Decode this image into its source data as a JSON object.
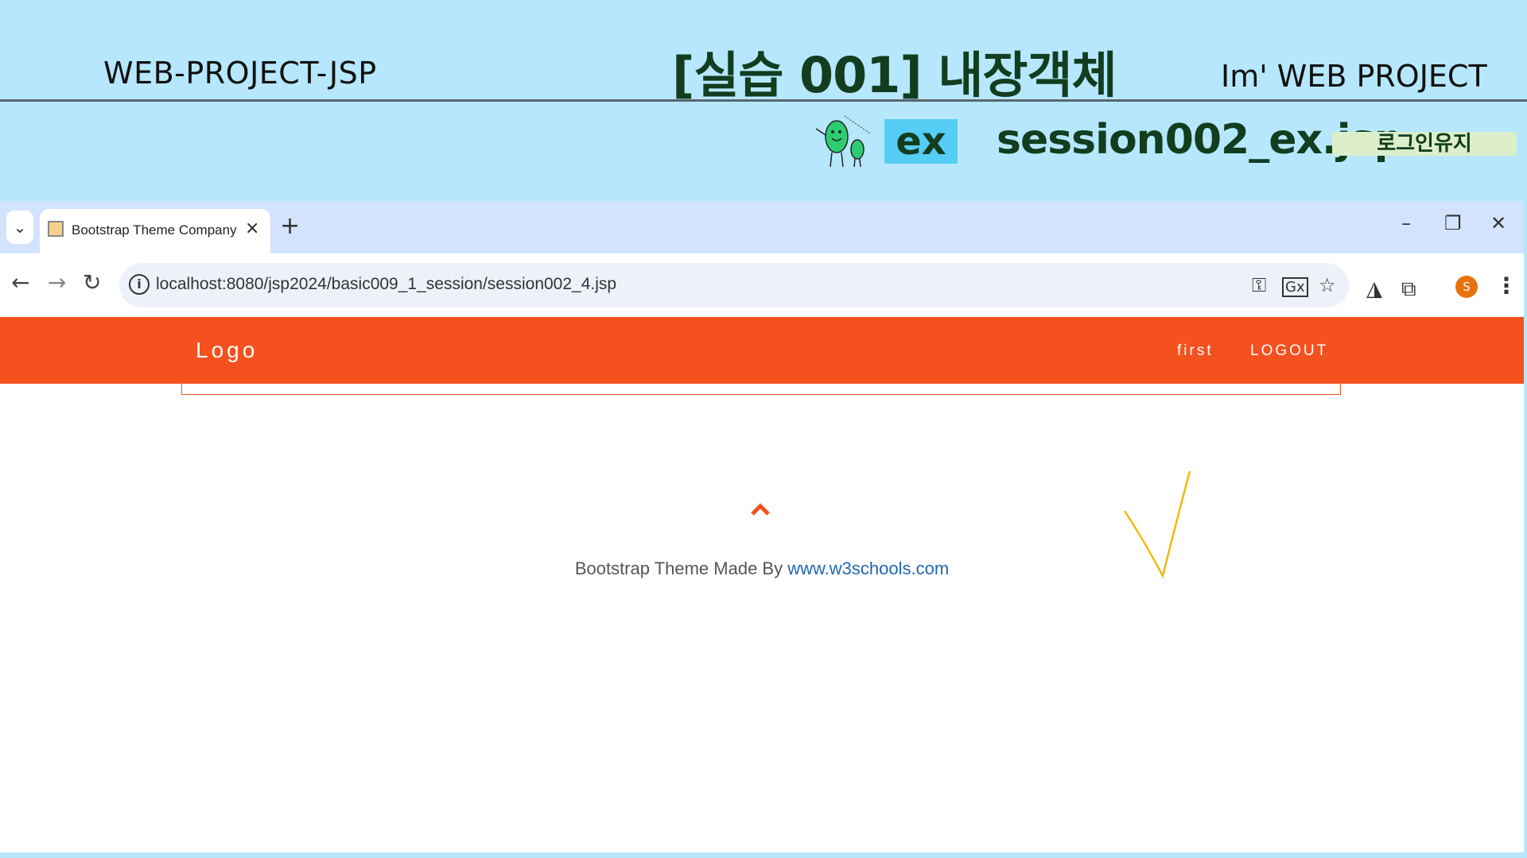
{
  "slide": {
    "left_title": "WEB-PROJECT-JSP",
    "center_title": "[실습 001]  내장객체",
    "right_title": "Im'  WEB PROJECT",
    "ex_label": "ex",
    "file_title": "session002_ex.jsp",
    "tag": "로그인유지"
  },
  "browser": {
    "tab": {
      "title": "Bootstrap Theme Company Pa",
      "close_glyph": "×",
      "favicon": "page-favicon"
    },
    "tab_list_glyph": "⌄",
    "new_tab_glyph": "+",
    "window_controls": {
      "minimize": "–",
      "restore": "❐",
      "close": "✕"
    },
    "toolbar": {
      "back": "←",
      "forward": "→",
      "reload": "↻",
      "url": "localhost:8080/jsp2024/basic009_1_session/session002_4.jsp",
      "info_glyph": "i",
      "key_icon": "⚿",
      "translate_icon": "Gx",
      "star_icon": "☆",
      "ext1_icon": "◮",
      "puzzle_icon": "⧉",
      "profile_initial": "S",
      "menu_icon": "⋮"
    }
  },
  "page": {
    "navbar": {
      "logo": "Logo",
      "links": [
        "first",
        "LOGOUT"
      ]
    },
    "footer": {
      "text": "Bootstrap Theme Made By ",
      "link": "www.w3schools.com"
    }
  },
  "colors": {
    "slide_bg": "#b6e7fc",
    "navbar": "#f4511e",
    "tabstrip": "#d3e3fd",
    "heading_green": "#123d1f"
  }
}
